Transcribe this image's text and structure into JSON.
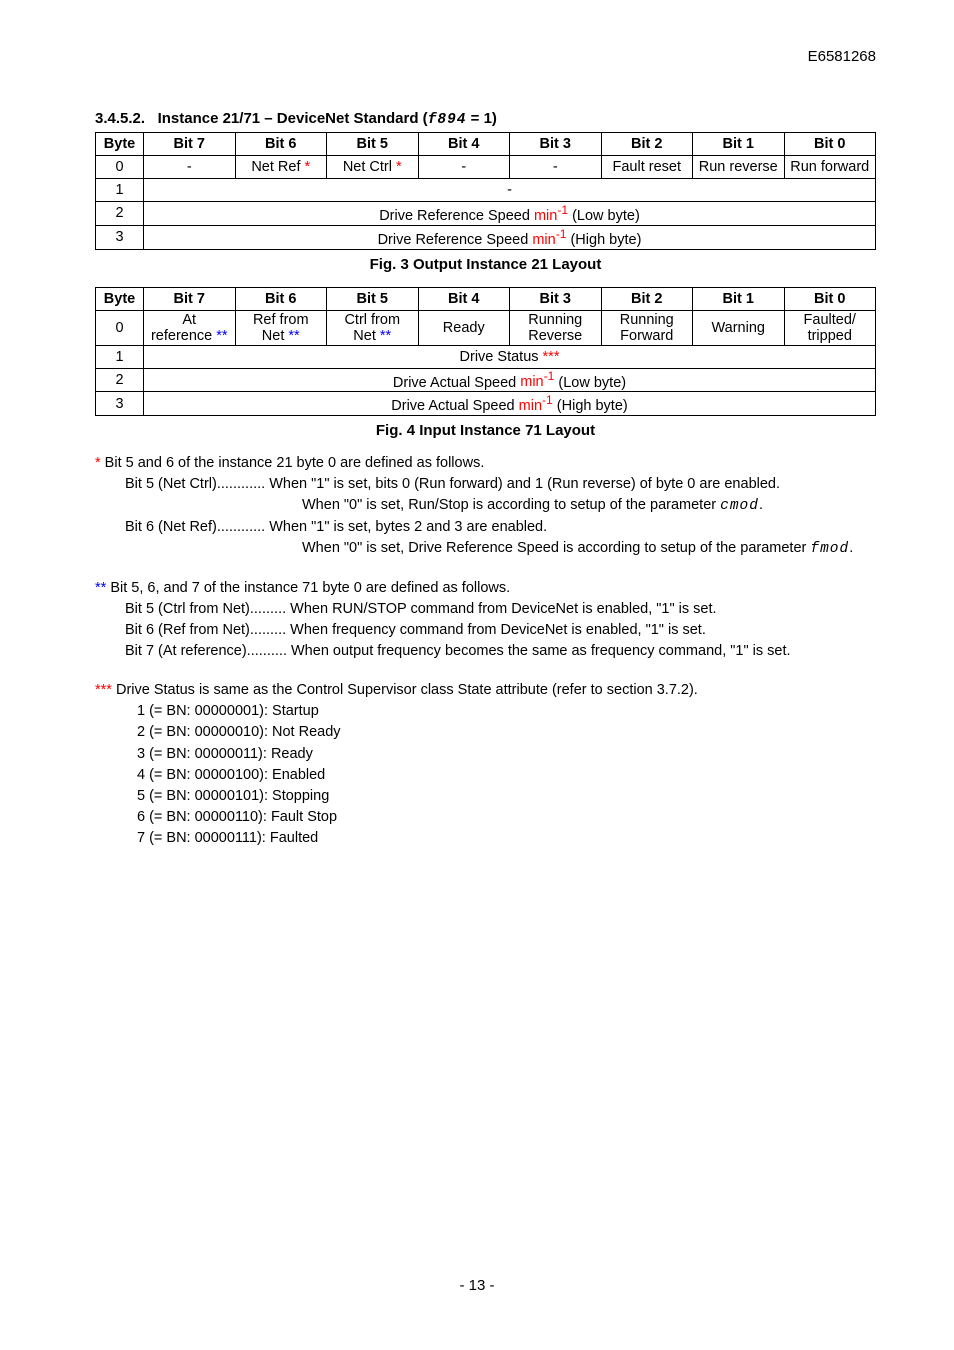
{
  "header_id": "E6581268",
  "section_3452": {
    "title_prefix": "3.4.5.2.",
    "title_text": "Instance 21/71 – DeviceNet Standard (",
    "title_glyph": "f894",
    "title_suffix": " = 1)"
  },
  "table1": {
    "headers": [
      "Byte",
      "Bit 7",
      "Bit 6",
      "Bit 5",
      "Bit 4",
      "Bit 3",
      "Bit 2",
      "Bit 1",
      "Bit 0"
    ],
    "r0": {
      "byte": "0",
      "b7": "-",
      "b6_text": "Net Ref",
      "b6_star": " *",
      "b5_text": "Net Ctrl",
      "b5_star": " *",
      "b4": "-",
      "b3": "-",
      "b2": "Fault reset",
      "b1": "Run reverse",
      "b0": "Run forward"
    },
    "r1": {
      "byte": "1",
      "span": "-"
    },
    "r2": {
      "byte": "2",
      "pre": "Drive Reference Speed ",
      "unit": "min",
      "exp": "-1",
      "post": " (Low byte)"
    },
    "r3": {
      "byte": "3",
      "pre": "Drive Reference Speed ",
      "unit": "min",
      "exp": "-1",
      "post": " (High byte)"
    }
  },
  "fig3": "Fig. 3 Output Instance 21 Layout",
  "table2": {
    "headers": [
      "Byte",
      "Bit 7",
      "Bit 6",
      "Bit 5",
      "Bit 4",
      "Bit 3",
      "Bit 2",
      "Bit 1",
      "Bit 0"
    ],
    "r0": {
      "byte": "0",
      "b7a": "At",
      "b7b": "reference ",
      "b7s": "**",
      "b6a": "Ref from",
      "b6b": "Net ",
      "b6s": "**",
      "b5a": "Ctrl from",
      "b5b": "Net ",
      "b5s": "**",
      "b4": "Ready",
      "b3a": "Running",
      "b3b": "Reverse",
      "b2a": "Running",
      "b2b": "Forward",
      "b1": "Warning",
      "b0a": "Faulted/",
      "b0b": "tripped"
    },
    "r1": {
      "byte": "1",
      "pre": "Drive Status ",
      "star": "***"
    },
    "r2": {
      "byte": "2",
      "pre": "Drive Actual Speed ",
      "unit": "min",
      "exp": "-1",
      "post": " (Low byte)"
    },
    "r3": {
      "byte": "3",
      "pre": "Drive Actual Speed ",
      "unit": "min",
      "exp": "-1",
      "post": " (High byte)"
    }
  },
  "fig4": "Fig. 4 Input Instance 71 Layout",
  "notes1": {
    "star": "*",
    "intro": " Bit 5 and 6 of the instance 21 byte 0 are defined as follows.",
    "bit5_label": "Bit 5 (Net Ctrl)............",
    "bit5_text": " When \"1\" is set, bits 0 (Run forward) and 1 (Run reverse) of byte 0 are enabled.",
    "bit5_when": "When \"0\" is set, Run/Stop is according to setup of the parameter ",
    "bit5_glyph": "cmod",
    "bit5_end": ".",
    "bit6_label": "Bit 6 (Net Ref)............",
    "bit6_text": " When \"1\" is set, bytes 2 and 3 are enabled.",
    "bit6_when": "When \"0\" is set, Drive Reference Speed is according to setup of the parameter ",
    "bit6_glyph": "fmod",
    "bit6_end": "."
  },
  "notes2": {
    "star": "**",
    "intro": " Bit 5, 6, and 7 of the instance 71 byte 0 are defined as follows.",
    "l1": "Bit 5 (Ctrl from Net)......... When RUN/STOP command from DeviceNet is enabled, \"1\" is set.",
    "l2": "Bit 6 (Ref from Net)......... When frequency command from DeviceNet is enabled, \"1\" is set.",
    "l3": "Bit 7 (At reference).......... When output frequency becomes the same as frequency command, \"1\" is set."
  },
  "notes3": {
    "star": "***",
    "intro": " Drive Status is same as the Control Supervisor class State attribute (refer to section 3.7.2).",
    "items": [
      "1 (= BN: 00000001): Startup",
      "2 (= BN: 00000010): Not Ready",
      "3 (= BN: 00000011): Ready",
      "4 (= BN: 00000100): Enabled",
      "5 (= BN: 00000101): Stopping",
      "6 (= BN: 00000110): Fault Stop",
      "7 (= BN: 00000111): Faulted"
    ]
  },
  "pagenum": "- 13 -"
}
